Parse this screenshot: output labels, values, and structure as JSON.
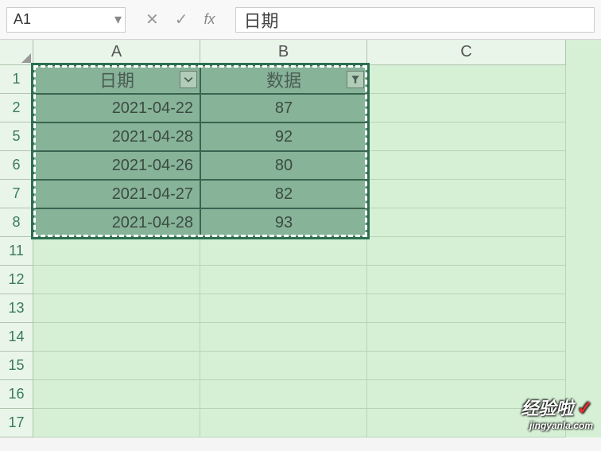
{
  "formula_bar": {
    "cell_ref": "A1",
    "formula_value": "日期"
  },
  "columns": [
    "A",
    "B",
    "C"
  ],
  "visible_rows": [
    "1",
    "2",
    "5",
    "6",
    "7",
    "8",
    "11",
    "12",
    "13",
    "14",
    "15",
    "16",
    "17"
  ],
  "table": {
    "headers": {
      "date": "日期",
      "data": "数据"
    },
    "rows": [
      {
        "row_num": "2",
        "date": "2021-04-22",
        "value": "87"
      },
      {
        "row_num": "5",
        "date": "2021-04-28",
        "value": "92"
      },
      {
        "row_num": "6",
        "date": "2021-04-26",
        "value": "80"
      },
      {
        "row_num": "7",
        "date": "2021-04-27",
        "value": "82"
      },
      {
        "row_num": "8",
        "date": "2021-04-28",
        "value": "93"
      }
    ]
  },
  "watermark": {
    "main": "经验啦",
    "check": "✓",
    "sub": "jingyanla.com"
  }
}
